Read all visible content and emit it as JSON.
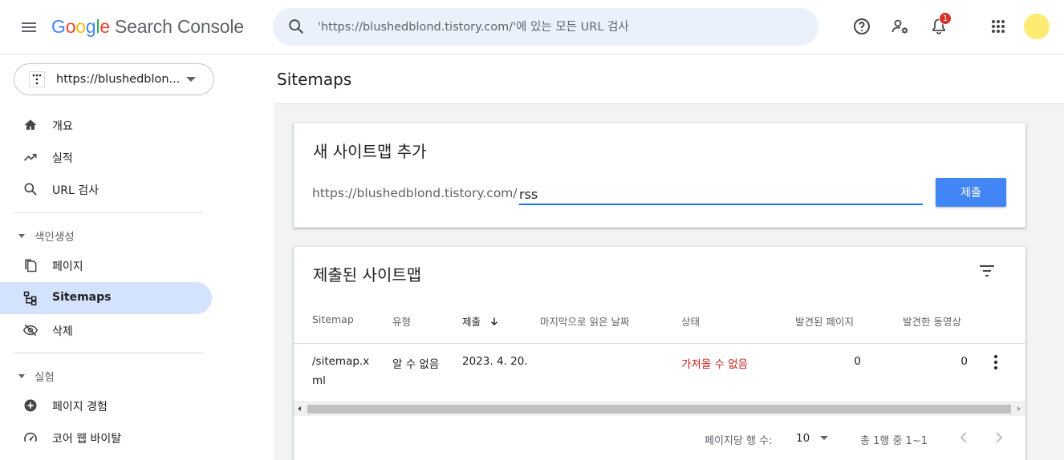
{
  "app": {
    "logo_letters": [
      "G",
      "o",
      "o",
      "g",
      "l",
      "e"
    ],
    "product": "Search Console"
  },
  "search": {
    "placeholder": "'https://blushedblond.tistory.com/'에 있는 모든 URL 검사"
  },
  "topbar": {
    "notification_count": "1",
    "icons": [
      "menu-icon",
      "search-icon",
      "help-icon",
      "admin-icon",
      "bell-icon",
      "apps-icon"
    ]
  },
  "property": {
    "label": "https://blushedblon..."
  },
  "sidebar": {
    "items_top": [
      {
        "label": "개요",
        "icon": "home-icon"
      },
      {
        "label": "실적",
        "icon": "trending-icon"
      },
      {
        "label": "URL 검사",
        "icon": "search-icon"
      }
    ],
    "section_indexing": "색인생성",
    "items_indexing": [
      {
        "label": "페이지",
        "icon": "pages-icon"
      },
      {
        "label": "Sitemaps",
        "icon": "sitemap-icon",
        "active": true
      },
      {
        "label": "삭제",
        "icon": "eye-off-icon"
      }
    ],
    "section_experience": "실험",
    "items_experience": [
      {
        "label": "페이지 경험",
        "icon": "plus-circle-icon"
      },
      {
        "label": "코어 웹 바이탈",
        "icon": "gauge-icon"
      }
    ]
  },
  "page": {
    "title": "Sitemaps"
  },
  "add_sitemap": {
    "title": "새 사이트맵 추가",
    "prefix": "https://blushedblond.tistory.com/",
    "input_value": "rss",
    "submit_label": "제출"
  },
  "submitted": {
    "title": "제출된 사이트맵",
    "columns": [
      "Sitemap",
      "유형",
      "제출",
      "마지막으로 읽은 날짜",
      "상태",
      "발견된 페이지",
      "발견한 동영상"
    ],
    "sort_column": "제출",
    "rows": [
      {
        "sitemap_line1": "/sitemap.x",
        "sitemap_line2": "ml",
        "type": "알 수 없음",
        "submitted": "2023. 4. 20.",
        "last_read": "",
        "status": "가져올 수 없음",
        "pages": "0",
        "videos": "0"
      }
    ],
    "pager": {
      "rows_per_page_label": "페이지당 행 수:",
      "rows_per_page": "10",
      "range": "총 1행 중 1~1"
    }
  },
  "colors": {
    "accent": "#4285f4",
    "active_nav": "#d3e3fd",
    "error": "#c5221f",
    "avatar": "#fdeb73",
    "badge": "#d93025"
  }
}
